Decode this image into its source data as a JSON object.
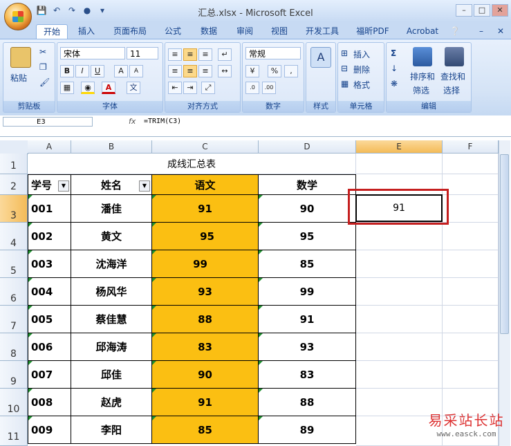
{
  "window": {
    "title": "汇总.xlsx - Microsoft Excel"
  },
  "tabs": [
    "开始",
    "插入",
    "页面布局",
    "公式",
    "数据",
    "审阅",
    "视图",
    "开发工具",
    "福昕PDF",
    "Acrobat"
  ],
  "ribbon": {
    "clipboard": {
      "paste": "粘贴",
      "label": "剪贴板"
    },
    "font": {
      "name": "宋体",
      "size": "11",
      "label": "字体"
    },
    "alignment": {
      "label": "对齐方式"
    },
    "number": {
      "format": "常规",
      "label": "数字"
    },
    "styles": {
      "label": "样式"
    },
    "cells": {
      "insert": "插入",
      "delete": "删除",
      "format": "格式",
      "label": "单元格"
    },
    "editing": {
      "sort": "排序和",
      "sort2": "筛选",
      "find": "查找和",
      "find2": "选择",
      "label": "编辑"
    }
  },
  "formula_bar": {
    "name": "E3",
    "fx": "fx",
    "formula": "=TRIM(C3)"
  },
  "columns": [
    "A",
    "B",
    "C",
    "D",
    "E",
    "F"
  ],
  "rows": [
    "1",
    "2",
    "3",
    "4",
    "5",
    "6",
    "7",
    "8",
    "9",
    "10",
    "11"
  ],
  "sheet": {
    "title": "成线汇总表",
    "headers": {
      "id": "学号",
      "name": "姓名",
      "chinese": "语文",
      "math": "数学"
    },
    "records": [
      {
        "id": "001",
        "name": "潘佳",
        "chinese": "91",
        "math": "90"
      },
      {
        "id": "002",
        "name": "黄文",
        "chinese": "95",
        "math": "95"
      },
      {
        "id": "003",
        "name": "沈海洋",
        "chinese": "99",
        "math": "85"
      },
      {
        "id": "004",
        "name": "杨风华",
        "chinese": "93",
        "math": "99"
      },
      {
        "id": "005",
        "name": "蔡佳慧",
        "chinese": "88",
        "math": "91"
      },
      {
        "id": "006",
        "name": "邱海涛",
        "chinese": "83",
        "math": "93"
      },
      {
        "id": "007",
        "name": "邱佳",
        "chinese": "90",
        "math": "83"
      },
      {
        "id": "008",
        "name": "赵虎",
        "chinese": "91",
        "math": "88"
      },
      {
        "id": "009",
        "name": "李阳",
        "chinese": "85",
        "math": "89"
      }
    ],
    "e3_value": "91"
  },
  "watermark": {
    "line1": "易采站长站",
    "line2": "www.easck.com"
  },
  "colors": {
    "highlight": "#fbbf12",
    "annotation": "#c51f1f"
  }
}
